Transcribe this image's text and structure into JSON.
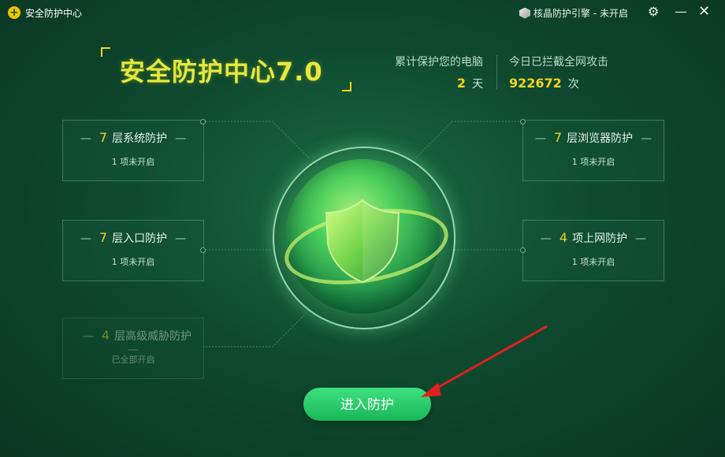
{
  "titlebar": {
    "app_title": "安全防护中心",
    "engine_status": "核晶防护引擎 - 未开启"
  },
  "header": {
    "brand_title": "安全防护中心7.0",
    "stats": [
      {
        "label": "累计保护您的电脑",
        "value": "2",
        "unit": "天"
      },
      {
        "label": "今日已拦截全网攻击",
        "value": "922672",
        "unit": "次"
      }
    ]
  },
  "cards": [
    {
      "count": "7",
      "name": "层系统防护",
      "status": "1 项未开启",
      "enabled": true
    },
    {
      "count": "7",
      "name": "层入口防护",
      "status": "1 项未开启",
      "enabled": true
    },
    {
      "count": "4",
      "name": "层高级威胁防护",
      "status": "已全部开启",
      "enabled": false
    },
    {
      "count": "7",
      "name": "层浏览器防护",
      "status": "1 项未开启",
      "enabled": true
    },
    {
      "count": "4",
      "name": "项上网防护",
      "status": "1 项未开启",
      "enabled": true
    }
  ],
  "main": {
    "enter_label": "进入防护"
  },
  "icons": {
    "gear": "gear-icon",
    "minimize": "minimize-icon",
    "close": "close-icon",
    "shield": "shield-icon",
    "engine": "cube-icon"
  },
  "colors": {
    "accent_yellow": "#f2d31b",
    "brand_yellow": "#e6e83a",
    "button_green": "#18b85a",
    "background": "#0f4a2f"
  }
}
